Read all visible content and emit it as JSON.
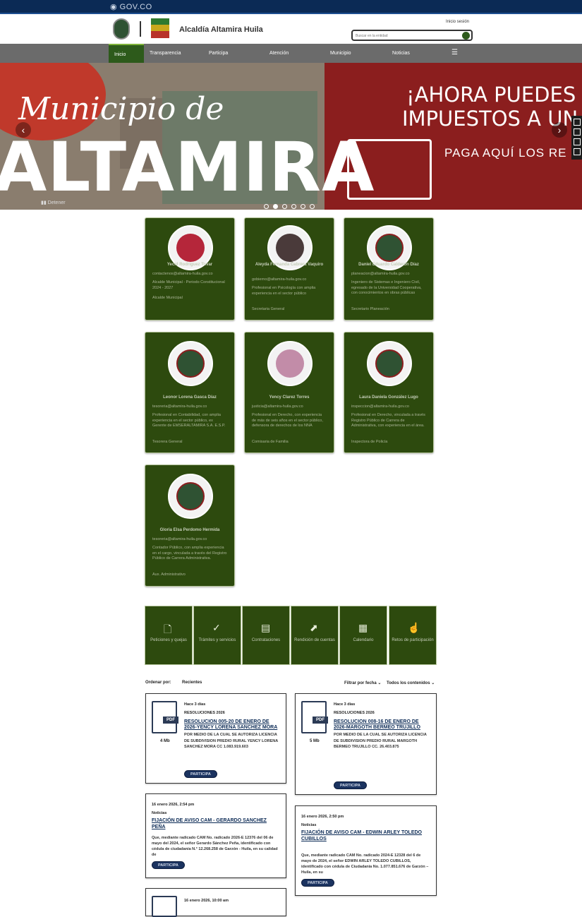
{
  "govbar": {
    "label": "GOV.CO"
  },
  "header": {
    "site_name": "Alcaldía Altamira Huila",
    "login": "Inicio sesión",
    "search_placeholder": "Buscar en la entidad"
  },
  "nav": {
    "items": [
      {
        "label": "Inicio"
      },
      {
        "label": "Transparencia"
      },
      {
        "label": "Participa"
      },
      {
        "label": "Atención"
      },
      {
        "label": "Municipio"
      },
      {
        "label": "Noticias"
      }
    ]
  },
  "hero": {
    "script": "Municipio de",
    "big": "ALTAMIRA",
    "right_line1": "¡AHORA PUEDES P",
    "right_line2": "IMPUESTOS A UN",
    "right_line3": "PAGA AQUÍ LOS RE",
    "stop_label": "Detener",
    "slides": 6,
    "active_slide": 2
  },
  "staff": [
    {
      "name": "Yecid Rodríguez Tovar",
      "email": "contactenos@altamira-huila.gov.co",
      "bio": "Alcalde Municipal - Periodo Constitucional 2024 - 2027",
      "role": "Alcalde Municipal",
      "photo": "person"
    },
    {
      "name": "Aleyda Fernanda Cabrera Vaquiro",
      "email": "gobierno@altamira-huila.gov.co",
      "bio": "Profesional en Psicología con amplia experiencia en el sector público",
      "role": "Secretaria General",
      "photo": "person"
    },
    {
      "name": "Daniel Eduardo Calderón Díaz",
      "email": "planeacion@altamira-huila.gov.co",
      "bio": "Ingeniero de Sistemas e Ingeniero Civil, egresado de la Universidad Cooperativa, con conocimientos en obras públicas",
      "role": "Secretario Planeación",
      "photo": "seal"
    },
    {
      "name": "Leonor Lorena Gasca Díaz",
      "email": "tesoreria@altamira-huila.gov.co",
      "bio": "Profesional en Contabilidad, con amplia experiencia en el sector público, ex Gerente de EMSERALTAMIRA S.A. E.S.P.",
      "role": "Tesorera General",
      "photo": "seal"
    },
    {
      "name": "Yency Clarez Torres",
      "email": "justicia@altamira-huila.gov.co",
      "bio": "Profesional en Derecho, con experiencia de más de seis años en el sector público, defensora de derechos de los NNA",
      "role": "Comisaria de Familia",
      "photo": "person"
    },
    {
      "name": "Laura Daniela González Lugo",
      "email": "inspeccion@altamira-huila.gov.co",
      "bio": "Profesional en Derecho, vinculada a través Registro Público de Carrera de Administrativa, con experiencia en el área.",
      "role": "Inspectora de Policía",
      "photo": "seal"
    },
    {
      "name": "Gloria Elsa Perdomo Hermida",
      "email": "tesoreria@altamira-huila.gov.co",
      "bio": "Contador Público, con amplia experiencia en el cargo, vinculada a través del Registro Público de Carrera Administrativa.",
      "role": "Aux. Administrativo",
      "photo": "seal"
    }
  ],
  "tiles": [
    {
      "label": "Peticiones y quejas",
      "icon": "document-icon"
    },
    {
      "label": "Trámites y servicios",
      "icon": "check-icon"
    },
    {
      "label": "Contrataciones",
      "icon": "contract-icon"
    },
    {
      "label": "Rendición de cuentas",
      "icon": "chart-icon"
    },
    {
      "label": "Calendario",
      "icon": "calendar-icon"
    },
    {
      "label": "Retos de participación",
      "icon": "hand-icon"
    }
  ],
  "sort": {
    "label": "Ordenar por:",
    "value": "Recientes",
    "filter_date": "Filtrar por fecha",
    "filter_content": "Todos los contenidos"
  },
  "docs": [
    {
      "age": "Hace 3 días",
      "category": "RESOLUCIONES 2026",
      "title": "RESOLUCION 005-20 DE ENERO DE 2026-YENCY LORENA SANCHEZ MORA",
      "desc": "POR MEDIO DE LA CUAL SE AUTORIZA LICENCIA DE SUBDIVISION PREDIO RURAL YENCY LORENA SANCHEZ MORA CC 1.083.919.603",
      "size": "4 Mb",
      "button": "PARTICIPA"
    },
    {
      "age": "Hace 3 días",
      "category": "RESOLUCIONES 2026",
      "title": "RESOLUCION 008-16 DE ENERO DE 2026-MARGOTH BERMEO TRUJILLO",
      "desc": "POR MEDIO DE LA CUAL SE AUTORIZA LICENCIA DE SUBDIVISION PREDIO RURAL MARGOTH BERMEO TRUJILLO CC. 26.403.875",
      "size": "5 Mb",
      "button": "PARTICIPA"
    }
  ],
  "news": [
    {
      "date": "16 enero 2026, 2:54 pm",
      "category": "Noticias",
      "title": "FIJACIÓN DE AVISO CAM - GERARDO SANCHEZ PEÑA",
      "body": "Que, mediante radicado CAM No. radicado 2026-E 12376 del 06 de mayo del 2024, el señor Gerardo Sánchez Peña, identificado con cédula de ciudadanía N.° 12.268.258 de Garzón - Huila, en su calidad de",
      "button": "PARTICIPA"
    },
    {
      "date": "16 enero 2026, 2:50 pm",
      "category": "Noticias",
      "title": "FIJACIÓN DE AVISO CAM - EDWIN ARLEY TOLEDO CUBILLOS",
      "body": "Que, mediante radicado CAM No. radicado 2024-E 12328 del 6 de mayo de 2024, el señor EDWIN ARLEY TOLEDO CUBILLOS, identificado con cédula de Ciudadanía No. 1.077.851.676 de Garzón – Huila, en su",
      "button": "PARTICIPA"
    },
    {
      "date": "16 enero 2026, 10:00 am",
      "category": "",
      "title": "",
      "body": "",
      "button": ""
    }
  ],
  "colors": {
    "green": "#2d4a0e",
    "navy": "#0b2a55",
    "nav_gray": "#6b6b6b",
    "hero_red": "#8b1e1e"
  }
}
